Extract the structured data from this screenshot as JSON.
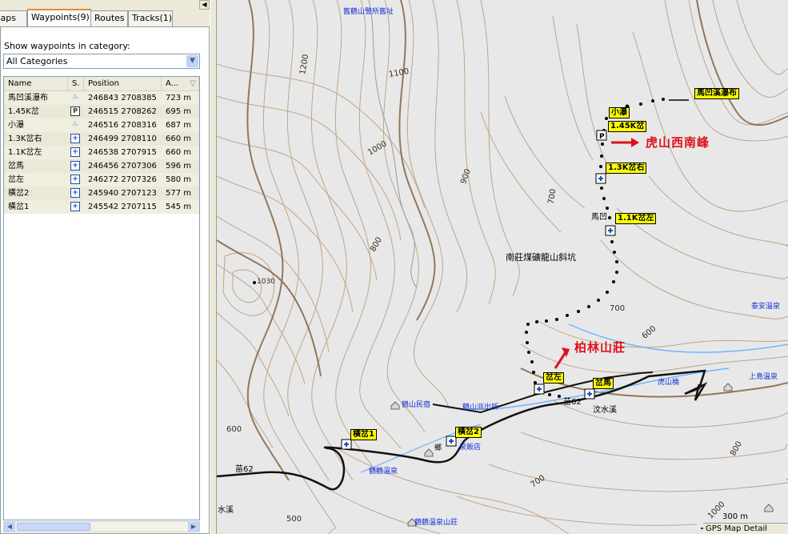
{
  "tabs": [
    {
      "label": "Maps"
    },
    {
      "label": "Waypoints(9)"
    },
    {
      "label": "Routes"
    },
    {
      "label": "Tracks(1)"
    }
  ],
  "panel": {
    "category_label": "Show waypoints in category:",
    "category_value": "All Categories"
  },
  "columns": {
    "name": "Name",
    "symbol": "S.",
    "position": "Position",
    "altitude": "A..."
  },
  "waypoints": [
    {
      "name": "馬凹溪瀑布",
      "symbol": "water",
      "position": "246843 2708385",
      "alt": "723 m"
    },
    {
      "name": "1.45K岔",
      "symbol": "park",
      "position": "246515 2708262",
      "alt": "695 m"
    },
    {
      "name": "小瀑",
      "symbol": "water",
      "position": "246516 2708316",
      "alt": "687 m"
    },
    {
      "name": "1.3K岔右",
      "symbol": "plus",
      "position": "246499 2708110",
      "alt": "660 m"
    },
    {
      "name": "1.1K岔左",
      "symbol": "plus",
      "position": "246538 2707915",
      "alt": "660 m"
    },
    {
      "name": "岔馬",
      "symbol": "plus",
      "position": "246456 2707306",
      "alt": "596 m"
    },
    {
      "name": "岔左",
      "symbol": "plus",
      "position": "246272 2707326",
      "alt": "580 m"
    },
    {
      "name": "橫岔2",
      "symbol": "plus",
      "position": "245940 2707123",
      "alt": "577 m"
    },
    {
      "name": "橫岔1",
      "symbol": "plus",
      "position": "245542 2707115",
      "alt": "545 m"
    }
  ],
  "map": {
    "annotations": {
      "peak": "虎山西南峰",
      "villa": "柏林山莊"
    },
    "waypoint_labels": {
      "falls": "馬凹溪瀑布",
      "k145": "1.45K岔",
      "small_falls": "小瀑",
      "k13": "1.3K岔右",
      "k11": "1.1K岔左",
      "cha_ma": "岔馬",
      "cha_zuo": "岔左",
      "heng2": "橫岔2",
      "heng1": "橫岔1"
    },
    "place_labels": {
      "mine": "南莊煤礦龍山斜坑",
      "old_police": "舊鶴山警所舊址",
      "lodge": "鶴山民宿",
      "police": "鶴山派出所",
      "hotel": "泉飯店",
      "hotspring": "鶴鶴溫泉",
      "villa2": "鶴鶴溫泉山莊",
      "tiger_bridge": "虎山橋",
      "upper_spring": "上島溫泉",
      "taian": "泰安溫泉",
      "wenshui": "汶水溪",
      "river2": "水溪",
      "road": "苗62",
      "road_b": "苗62",
      "horse": "馬凹",
      "peak_height": "1030",
      "zhong": "鄉"
    },
    "contour_labels": [
      "1200",
      "1100",
      "1000",
      "900",
      "800",
      "700",
      "700",
      "600",
      "600",
      "800",
      "700",
      "1000",
      "500"
    ],
    "scale": "300 m",
    "footer": "GPS Map Detail"
  }
}
